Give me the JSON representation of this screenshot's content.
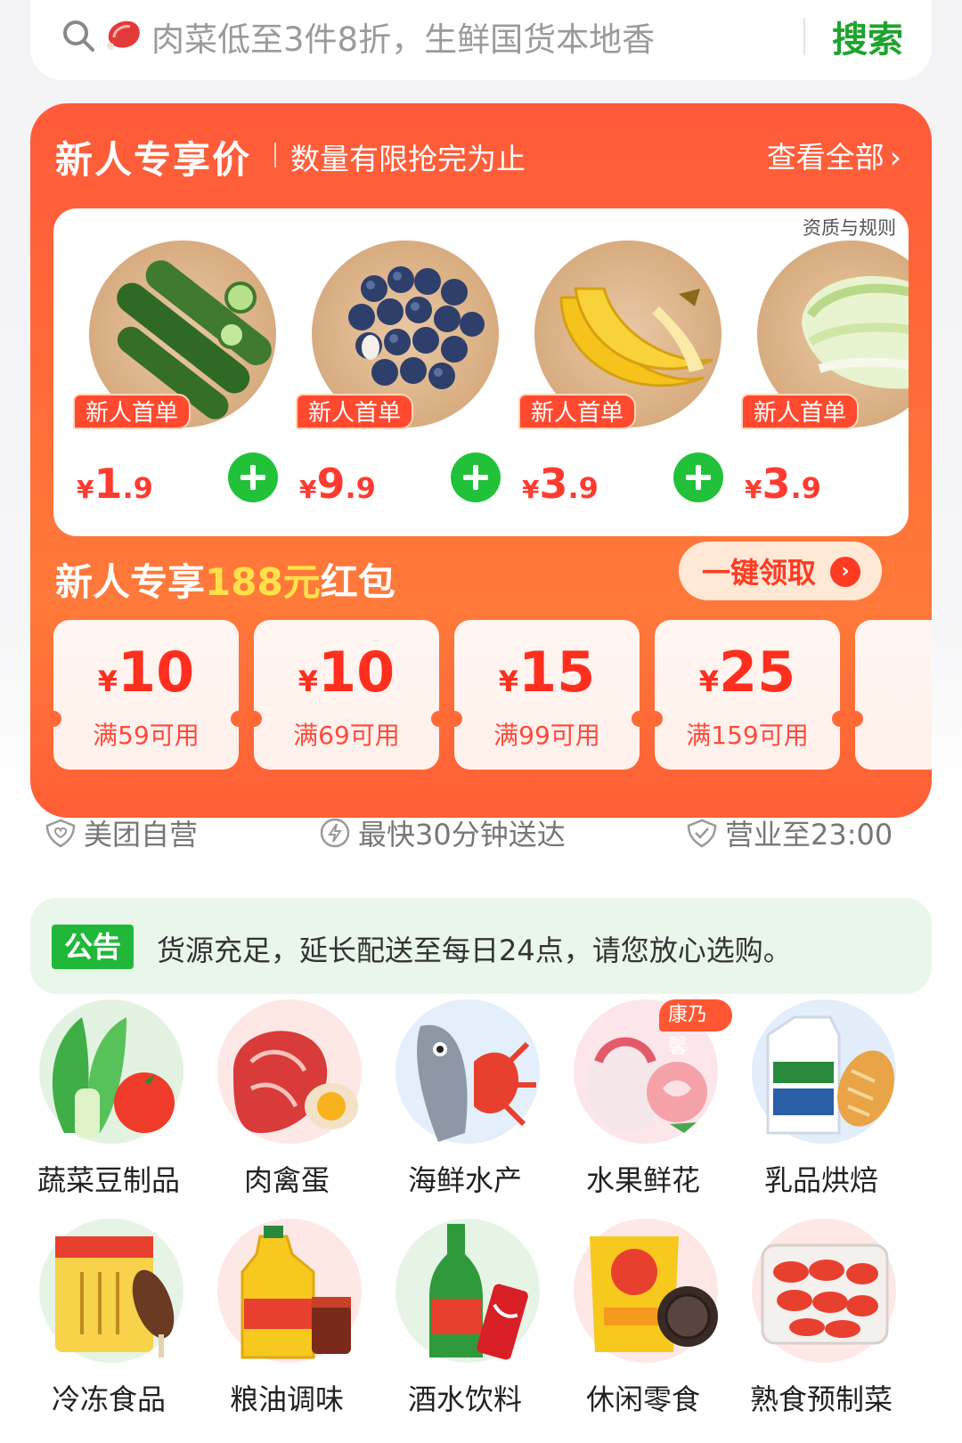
{
  "search": {
    "placeholder": "肉菜低至3件8折，生鲜国货本地香",
    "button": "搜索",
    "icons": [
      "search-icon",
      "meat-icon"
    ]
  },
  "promo": {
    "title": "新人专享价",
    "subtitle": "数量有限抢完为止",
    "view_all": "查看全部",
    "rules": "资质与规则",
    "products": [
      {
        "badge": "新人首单",
        "yen": "¥",
        "int": "1",
        "dec": ".9",
        "icon": "cucumber-icon"
      },
      {
        "badge": "新人首单",
        "yen": "¥",
        "int": "9",
        "dec": ".9",
        "icon": "blueberry-icon"
      },
      {
        "badge": "新人首单",
        "yen": "¥",
        "int": "3",
        "dec": ".9",
        "icon": "banana-icon"
      },
      {
        "badge": "新人首单",
        "yen": "¥",
        "int": "3",
        "dec": ".9",
        "icon": "cabbage-icon"
      }
    ],
    "redpacket": {
      "prefix": "新人专享",
      "amount": "188元",
      "suffix": "红包"
    },
    "claim": "一键领取",
    "coupons": [
      {
        "yen": "¥",
        "value": "10",
        "cond": "满59可用"
      },
      {
        "yen": "¥",
        "value": "10",
        "cond": "满69可用"
      },
      {
        "yen": "¥",
        "value": "15",
        "cond": "满99可用"
      },
      {
        "yen": "¥",
        "value": "25",
        "cond": "满159可用"
      }
    ]
  },
  "features": [
    {
      "label": "美团自营",
      "icon": "heart-shield-icon"
    },
    {
      "label": "最快30分钟送达",
      "icon": "lightning-icon"
    },
    {
      "label": "营业至23:00",
      "icon": "check-shield-icon"
    }
  ],
  "notice": {
    "tag": "公告",
    "text": "货源充足，延长配送至每日24点，请您放心选购。"
  },
  "categories": [
    {
      "label": "蔬菜豆制品",
      "icon": "vegetable-icon",
      "color": "#e3f3e2"
    },
    {
      "label": "肉禽蛋",
      "icon": "meat-egg-icon",
      "color": "#fde8e6"
    },
    {
      "label": "海鲜水产",
      "icon": "seafood-icon",
      "color": "#e3f0fb"
    },
    {
      "label": "水果鲜花",
      "icon": "fruit-flower-icon",
      "color": "#fde6ea",
      "tag": "康乃馨"
    },
    {
      "label": "乳品烘焙",
      "icon": "dairy-bakery-icon",
      "color": "#e3eefb"
    },
    {
      "label": "冷冻食品",
      "icon": "frozen-food-icon",
      "color": "#e6f4e6"
    },
    {
      "label": "粮油调味",
      "icon": "oil-seasoning-icon",
      "color": "#fde8e6"
    },
    {
      "label": "酒水饮料",
      "icon": "drinks-icon",
      "color": "#e6f4e6"
    },
    {
      "label": "休闲零食",
      "icon": "snacks-icon",
      "color": "#fde8e6"
    },
    {
      "label": "熟食预制菜",
      "icon": "prepared-food-icon",
      "color": "#fde8e6"
    }
  ]
}
